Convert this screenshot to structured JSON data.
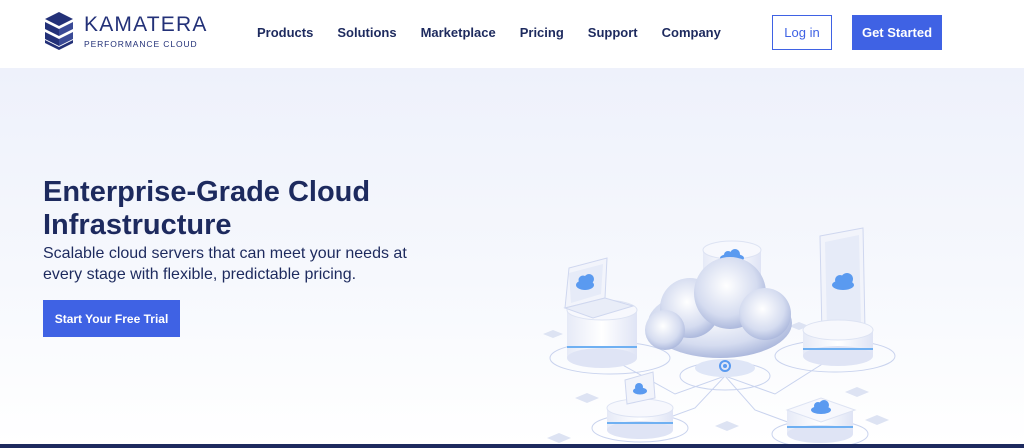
{
  "brand": {
    "name": "KAMATERA",
    "tagline": "PERFORMANCE CLOUD"
  },
  "nav": {
    "items": [
      {
        "label": "Products",
        "key": "products"
      },
      {
        "label": "Solutions",
        "key": "solutions"
      },
      {
        "label": "Marketplace",
        "key": "marketplace"
      },
      {
        "label": "Pricing",
        "key": "pricing"
      },
      {
        "label": "Support",
        "key": "support"
      },
      {
        "label": "Company",
        "key": "company"
      }
    ]
  },
  "header": {
    "login_label": "Log in",
    "get_started_label": "Get Started"
  },
  "hero": {
    "title": "Enterprise-Grade Cloud Infrastructure",
    "subtitle": "Scalable cloud servers that can meet your needs at every stage with flexible, predictable pricing.",
    "cta_label": "Start Your Free Trial"
  },
  "colors": {
    "brand": "#233178",
    "accent": "#3f62e4",
    "text": "#1d2a5e",
    "hero_bg": "#eef1fb"
  },
  "icons": [
    "kamatera-logo-icon",
    "cloud-icon",
    "laptop-icon",
    "tablet-icon",
    "server-icon"
  ]
}
